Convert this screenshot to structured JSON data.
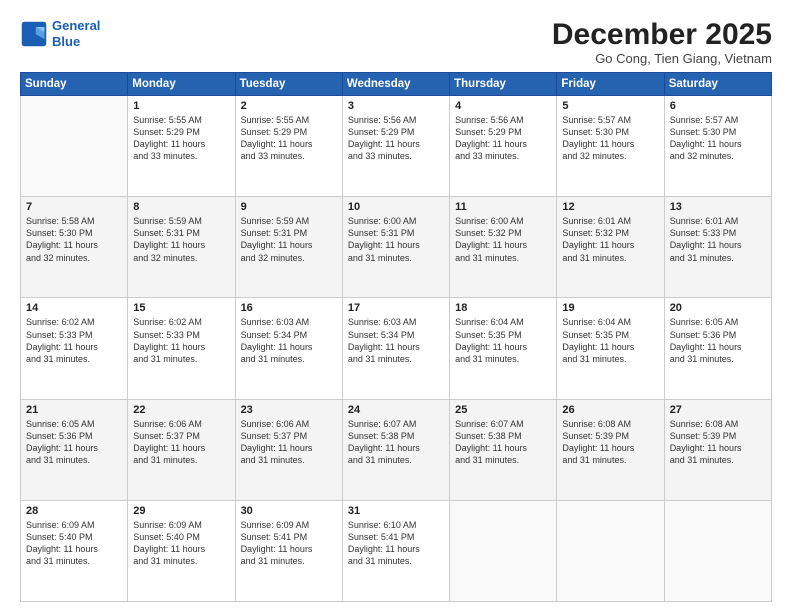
{
  "header": {
    "logo_line1": "General",
    "logo_line2": "Blue",
    "month": "December 2025",
    "location": "Go Cong, Tien Giang, Vietnam"
  },
  "weekdays": [
    "Sunday",
    "Monday",
    "Tuesday",
    "Wednesday",
    "Thursday",
    "Friday",
    "Saturday"
  ],
  "weeks": [
    [
      {
        "day": "",
        "text": ""
      },
      {
        "day": "1",
        "text": "Sunrise: 5:55 AM\nSunset: 5:29 PM\nDaylight: 11 hours\nand 33 minutes."
      },
      {
        "day": "2",
        "text": "Sunrise: 5:55 AM\nSunset: 5:29 PM\nDaylight: 11 hours\nand 33 minutes."
      },
      {
        "day": "3",
        "text": "Sunrise: 5:56 AM\nSunset: 5:29 PM\nDaylight: 11 hours\nand 33 minutes."
      },
      {
        "day": "4",
        "text": "Sunrise: 5:56 AM\nSunset: 5:29 PM\nDaylight: 11 hours\nand 33 minutes."
      },
      {
        "day": "5",
        "text": "Sunrise: 5:57 AM\nSunset: 5:30 PM\nDaylight: 11 hours\nand 32 minutes."
      },
      {
        "day": "6",
        "text": "Sunrise: 5:57 AM\nSunset: 5:30 PM\nDaylight: 11 hours\nand 32 minutes."
      }
    ],
    [
      {
        "day": "7",
        "text": "Sunrise: 5:58 AM\nSunset: 5:30 PM\nDaylight: 11 hours\nand 32 minutes."
      },
      {
        "day": "8",
        "text": "Sunrise: 5:59 AM\nSunset: 5:31 PM\nDaylight: 11 hours\nand 32 minutes."
      },
      {
        "day": "9",
        "text": "Sunrise: 5:59 AM\nSunset: 5:31 PM\nDaylight: 11 hours\nand 32 minutes."
      },
      {
        "day": "10",
        "text": "Sunrise: 6:00 AM\nSunset: 5:31 PM\nDaylight: 11 hours\nand 31 minutes."
      },
      {
        "day": "11",
        "text": "Sunrise: 6:00 AM\nSunset: 5:32 PM\nDaylight: 11 hours\nand 31 minutes."
      },
      {
        "day": "12",
        "text": "Sunrise: 6:01 AM\nSunset: 5:32 PM\nDaylight: 11 hours\nand 31 minutes."
      },
      {
        "day": "13",
        "text": "Sunrise: 6:01 AM\nSunset: 5:33 PM\nDaylight: 11 hours\nand 31 minutes."
      }
    ],
    [
      {
        "day": "14",
        "text": "Sunrise: 6:02 AM\nSunset: 5:33 PM\nDaylight: 11 hours\nand 31 minutes."
      },
      {
        "day": "15",
        "text": "Sunrise: 6:02 AM\nSunset: 5:33 PM\nDaylight: 11 hours\nand 31 minutes."
      },
      {
        "day": "16",
        "text": "Sunrise: 6:03 AM\nSunset: 5:34 PM\nDaylight: 11 hours\nand 31 minutes."
      },
      {
        "day": "17",
        "text": "Sunrise: 6:03 AM\nSunset: 5:34 PM\nDaylight: 11 hours\nand 31 minutes."
      },
      {
        "day": "18",
        "text": "Sunrise: 6:04 AM\nSunset: 5:35 PM\nDaylight: 11 hours\nand 31 minutes."
      },
      {
        "day": "19",
        "text": "Sunrise: 6:04 AM\nSunset: 5:35 PM\nDaylight: 11 hours\nand 31 minutes."
      },
      {
        "day": "20",
        "text": "Sunrise: 6:05 AM\nSunset: 5:36 PM\nDaylight: 11 hours\nand 31 minutes."
      }
    ],
    [
      {
        "day": "21",
        "text": "Sunrise: 6:05 AM\nSunset: 5:36 PM\nDaylight: 11 hours\nand 31 minutes."
      },
      {
        "day": "22",
        "text": "Sunrise: 6:06 AM\nSunset: 5:37 PM\nDaylight: 11 hours\nand 31 minutes."
      },
      {
        "day": "23",
        "text": "Sunrise: 6:06 AM\nSunset: 5:37 PM\nDaylight: 11 hours\nand 31 minutes."
      },
      {
        "day": "24",
        "text": "Sunrise: 6:07 AM\nSunset: 5:38 PM\nDaylight: 11 hours\nand 31 minutes."
      },
      {
        "day": "25",
        "text": "Sunrise: 6:07 AM\nSunset: 5:38 PM\nDaylight: 11 hours\nand 31 minutes."
      },
      {
        "day": "26",
        "text": "Sunrise: 6:08 AM\nSunset: 5:39 PM\nDaylight: 11 hours\nand 31 minutes."
      },
      {
        "day": "27",
        "text": "Sunrise: 6:08 AM\nSunset: 5:39 PM\nDaylight: 11 hours\nand 31 minutes."
      }
    ],
    [
      {
        "day": "28",
        "text": "Sunrise: 6:09 AM\nSunset: 5:40 PM\nDaylight: 11 hours\nand 31 minutes."
      },
      {
        "day": "29",
        "text": "Sunrise: 6:09 AM\nSunset: 5:40 PM\nDaylight: 11 hours\nand 31 minutes."
      },
      {
        "day": "30",
        "text": "Sunrise: 6:09 AM\nSunset: 5:41 PM\nDaylight: 11 hours\nand 31 minutes."
      },
      {
        "day": "31",
        "text": "Sunrise: 6:10 AM\nSunset: 5:41 PM\nDaylight: 11 hours\nand 31 minutes."
      },
      {
        "day": "",
        "text": ""
      },
      {
        "day": "",
        "text": ""
      },
      {
        "day": "",
        "text": ""
      }
    ]
  ]
}
